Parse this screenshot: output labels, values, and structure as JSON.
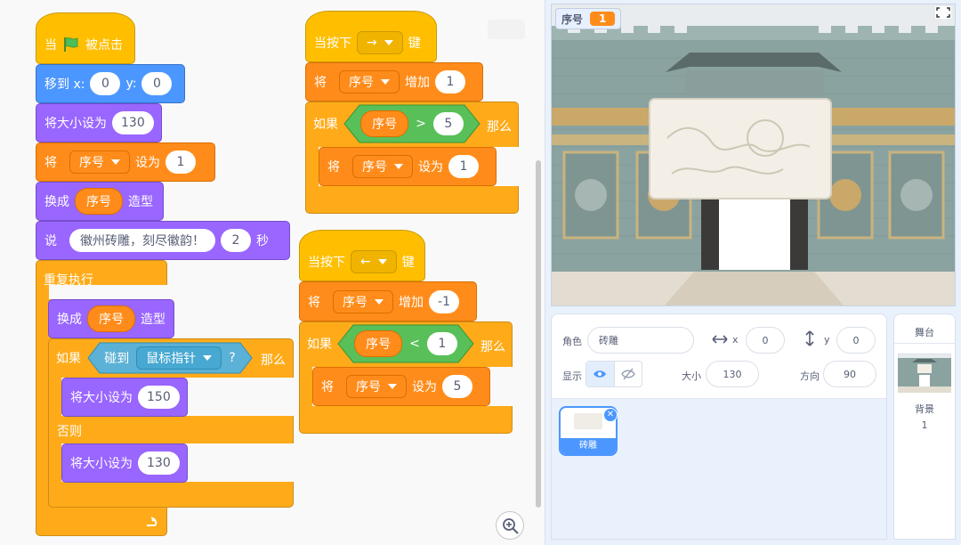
{
  "code": {
    "script1": {
      "when_flag": {
        "pre": "当",
        "post": "被点击"
      },
      "goto": {
        "label": "移到 x:",
        "x": "0",
        "y_label": "y:",
        "y": "0"
      },
      "set_size": {
        "label": "将大小设为",
        "value": "130"
      },
      "set_var": {
        "pre": "将",
        "var": "序号",
        "mid": "设为",
        "value": "1"
      },
      "switch_costume": {
        "pre": "换成",
        "var": "序号",
        "post": "造型"
      },
      "say": {
        "pre": "说",
        "text": "徽州砖雕，刻尽徽韵！",
        "secs": "2",
        "post": "秒"
      },
      "forever": {
        "label": "重复执行"
      },
      "inner_switch": {
        "pre": "换成",
        "var": "序号",
        "post": "造型"
      },
      "if_else": {
        "if": "如果",
        "touch": "碰到",
        "target": "鼠标指针",
        "q": "?",
        "then": "那么",
        "else": "否则"
      },
      "size_true": {
        "label": "将大小设为",
        "value": "150"
      },
      "size_false": {
        "label": "将大小设为",
        "value": "130"
      }
    },
    "script2": {
      "hat": {
        "pre": "当按下",
        "key": "→",
        "post": "键"
      },
      "change": {
        "pre": "将",
        "var": "序号",
        "mid": "增加",
        "value": "1"
      },
      "if": {
        "if": "如果",
        "var": "序号",
        "op": ">",
        "value": "5",
        "then": "那么"
      },
      "set": {
        "pre": "将",
        "var": "序号",
        "mid": "设为",
        "value": "1"
      }
    },
    "script3": {
      "hat": {
        "pre": "当按下",
        "key": "←",
        "post": "键"
      },
      "change": {
        "pre": "将",
        "var": "序号",
        "mid": "增加",
        "value": "-1"
      },
      "if": {
        "if": "如果",
        "var": "序号",
        "op": "<",
        "value": "1",
        "then": "那么"
      },
      "set": {
        "pre": "将",
        "var": "序号",
        "mid": "设为",
        "value": "5"
      }
    }
  },
  "stage": {
    "monitor": {
      "name": "序号",
      "value": "1"
    }
  },
  "sprite_info": {
    "sprite_label": "角色",
    "sprite_name": "砖雕",
    "x_label": "x",
    "x": "0",
    "y_label": "y",
    "y": "0",
    "show_label": "显示",
    "size_label": "大小",
    "size": "130",
    "direction_label": "方向",
    "direction": "90"
  },
  "sprite_list": [
    {
      "name": "砖雕"
    }
  ],
  "stage_panel": {
    "title": "舞台",
    "backdrop_label": "背景",
    "backdrop_count": "1"
  }
}
